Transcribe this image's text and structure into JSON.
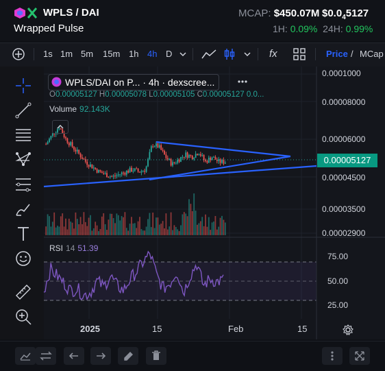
{
  "header": {
    "pair": "WPLS / DAI",
    "subtitle": "Wrapped Pulse",
    "mcap_label": "MCAP:",
    "mcap_value": "$450.07M",
    "price_prefix": "$0.0",
    "price_sub": "4",
    "price_suffix": "5127",
    "chg_1h_label": "1H:",
    "chg_1h_value": "0.09%",
    "chg_24h_label": "24H:",
    "chg_24h_value": "0.99%"
  },
  "toolbar": {
    "intervals": [
      "1s",
      "1m",
      "5m",
      "15m",
      "1h",
      "4h",
      "D"
    ],
    "active_interval": "4h",
    "price_label": "Price",
    "mcap_label": "MCap",
    "separator": "/",
    "fx_label": "fx"
  },
  "legend": {
    "title": "WPLS/DAI on P... · 4h · dexscree...",
    "o_label": "O",
    "o_value": "0.00005127",
    "h_label": "H",
    "h_value": "0.00005078",
    "l_label": "L",
    "l_value": "0.00005105",
    "c_label": "C",
    "c_value": "0.00005127",
    "trail": "0.0...",
    "volume_label": "Volume",
    "volume_value": "92.143K",
    "rsi_label": "RSI",
    "rsi_period": "14",
    "rsi_value": "51.39"
  },
  "axis": {
    "price_ticks": [
      "0.0001000",
      "0.00008000",
      "0.00006000",
      "0.00004500",
      "0.00003500",
      "0.00002900"
    ],
    "current_price": "0.00005127",
    "rsi_ticks": [
      "75.00",
      "50.00",
      "25.00"
    ],
    "x_ticks": [
      "2025",
      "15",
      "Feb",
      "15"
    ]
  },
  "colors": {
    "accent": "#2962ff",
    "up": "#26a69a",
    "down": "#ef5350",
    "rsi": "#7e57c2",
    "trendline": "#2962ff"
  },
  "chart_data": {
    "type": "candlestick",
    "interval": "4h",
    "series": [
      {
        "name": "WPLS/DAI",
        "values": [
          5.8e-05,
          6.2e-05,
          6.5e-05,
          6e-05,
          5.7e-05,
          5.4e-05,
          5.1e-05,
          4.9e-05,
          4.7e-05,
          4.6e-05,
          4.5e-05,
          4.6e-05,
          4.7e-05,
          4.8e-05,
          4.7e-05,
          4.8e-05,
          5.8e-05,
          5.7e-05,
          5.3e-05,
          5e-05,
          5.2e-05,
          5.4e-05,
          5.3e-05,
          5.5e-05,
          5.1e-05,
          5.3e-05,
          5.1e-05,
          5.1e-05
        ]
      },
      {
        "name": "Volume",
        "values": []
      },
      {
        "name": "RSI",
        "values": [
          40,
          62,
          55,
          48,
          40,
          42,
          35,
          38,
          50,
          44,
          55,
          45,
          40,
          52,
          60,
          70,
          78,
          55,
          42,
          48,
          60,
          38,
          55,
          68,
          45,
          52,
          49,
          51
        ]
      }
    ],
    "rsi_levels": [
      70,
      50,
      30
    ]
  }
}
